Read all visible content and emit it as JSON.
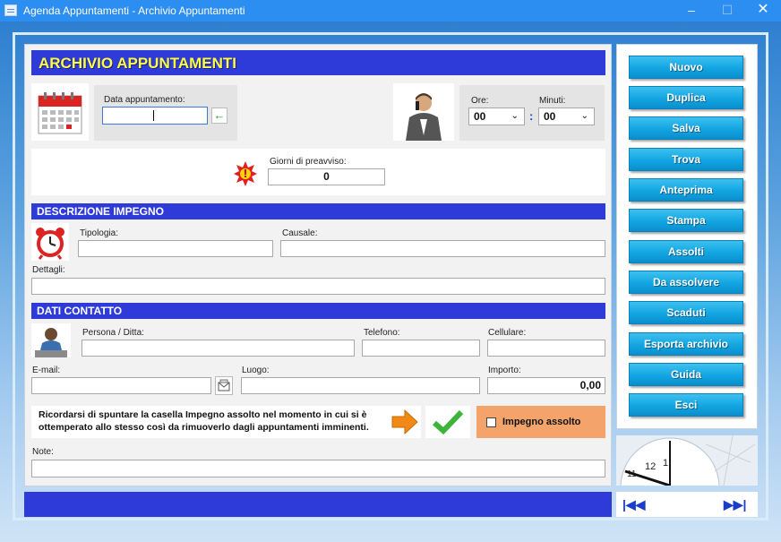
{
  "window": {
    "title": "Agenda Appuntamenti - Archivio Appuntamenti",
    "min": "–",
    "max": "☐",
    "close": "✕"
  },
  "header": {
    "title": "ARCHIVIO APPUNTAMENTI"
  },
  "date": {
    "label": "Data appuntamento:",
    "value": ""
  },
  "time": {
    "ore_label": "Ore:",
    "ore_value": "00",
    "minuti_label": "Minuti:",
    "minuti_value": "00",
    "separator": ":"
  },
  "preavviso": {
    "label": "Giorni di preavviso:",
    "value": "0"
  },
  "descrizione": {
    "title": "DESCRIZIONE IMPEGNO",
    "tipologia_label": "Tipologia:",
    "causale_label": "Causale:",
    "dettagli_label": "Dettagli:"
  },
  "contatto": {
    "title": "DATI CONTATTO",
    "persona_label": "Persona / Ditta:",
    "telefono_label": "Telefono:",
    "cellulare_label": "Cellulare:",
    "email_label": "E-mail:",
    "luogo_label": "Luogo:",
    "importo_label": "Importo:",
    "importo_value": "0,00"
  },
  "reminder": {
    "text": "Ricordarsi di spuntare la casella Impegno assolto nel momento in cui si è ottemperato allo stesso così da rimuoverlo dagli appuntamenti imminenti."
  },
  "assolto": {
    "label": "Impegno assolto",
    "checked": false
  },
  "note": {
    "label": "Note:"
  },
  "buttons": [
    "Nuovo",
    "Duplica",
    "Salva",
    "Trova",
    "Anteprima",
    "Stampa",
    "Assolti",
    "Da assolvere",
    "Scaduti",
    "Esporta archivio",
    "Guida",
    "Esci"
  ],
  "nav": {
    "first": "|◀◀",
    "last": "▶▶|"
  },
  "clock": {
    "n11": "11",
    "n12": "12",
    "n1": "1"
  },
  "colors": {
    "header_blue": "#2f3bd9",
    "button_cyan": "#12a5e2",
    "assolto_orange": "#f4a46a"
  }
}
